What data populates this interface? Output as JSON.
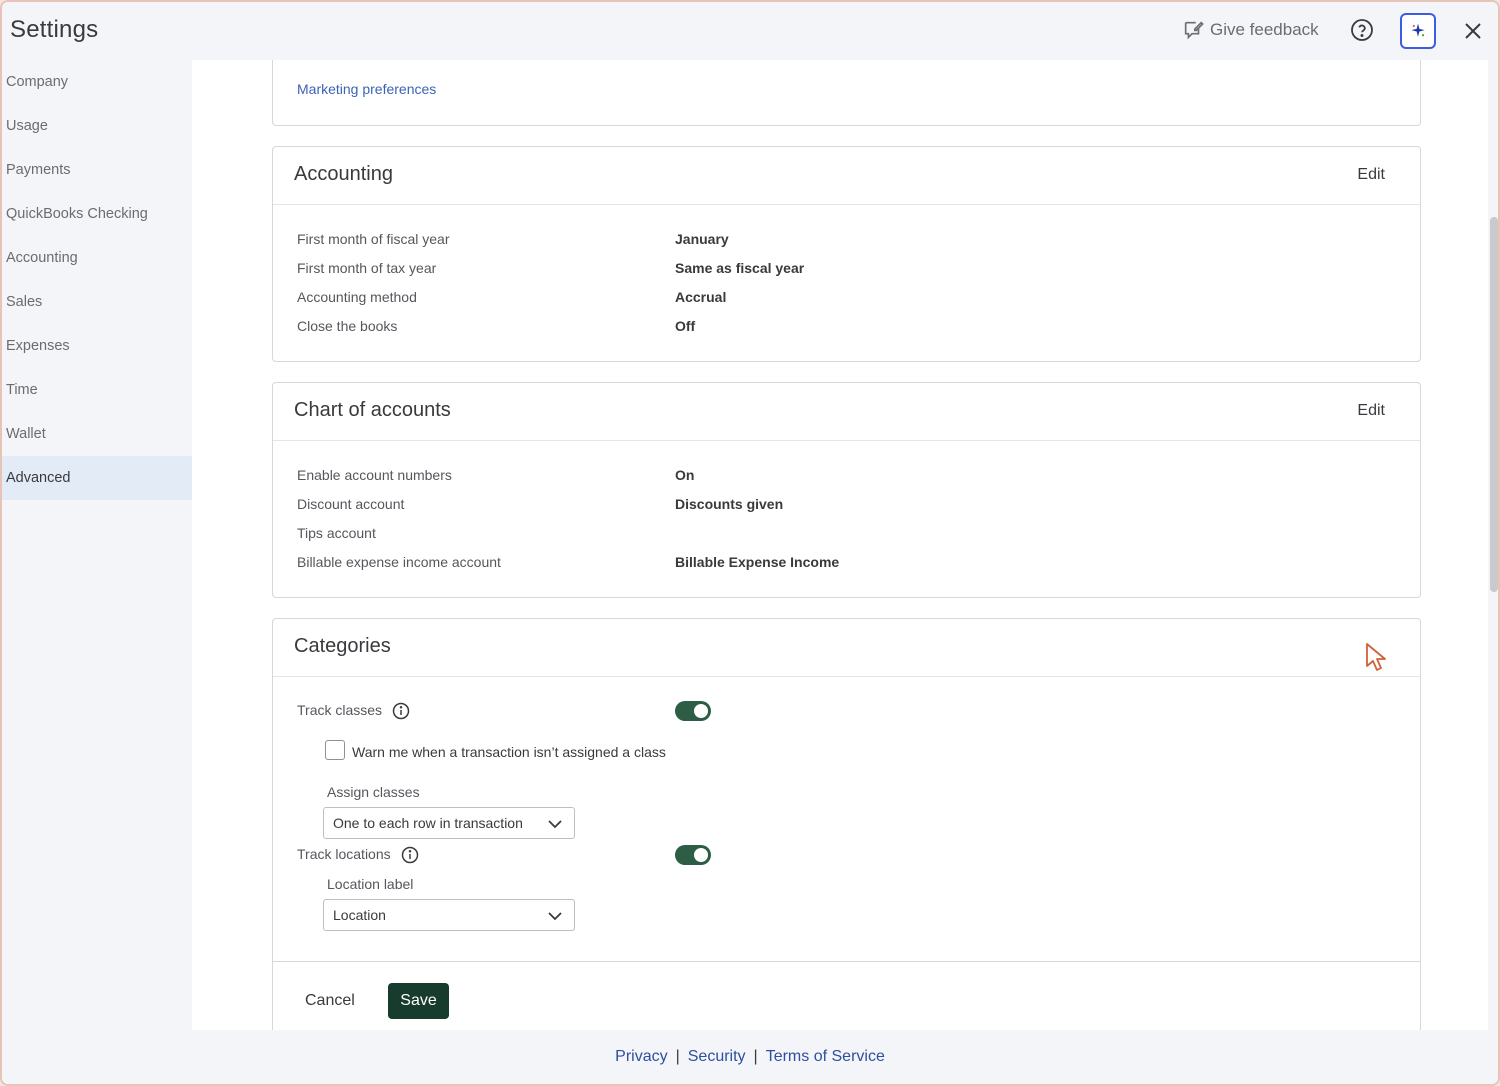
{
  "header": {
    "title": "Settings",
    "feedback_label": "Give feedback"
  },
  "sidebar": {
    "items": [
      {
        "label": "Company"
      },
      {
        "label": "Usage"
      },
      {
        "label": "Payments"
      },
      {
        "label": "QuickBooks Checking"
      },
      {
        "label": "Accounting"
      },
      {
        "label": "Sales"
      },
      {
        "label": "Expenses"
      },
      {
        "label": "Time"
      },
      {
        "label": "Wallet"
      },
      {
        "label": "Advanced"
      }
    ],
    "active": "Advanced"
  },
  "company_card": {
    "link": "Marketing preferences"
  },
  "accounting": {
    "title": "Accounting",
    "edit_label": "Edit",
    "rows": [
      {
        "label": "First month of fiscal year",
        "value": "January"
      },
      {
        "label": "First month of tax year",
        "value": "Same as fiscal year"
      },
      {
        "label": "Accounting method",
        "value": "Accrual"
      },
      {
        "label": "Close the books",
        "value": "Off"
      }
    ]
  },
  "chart_of_accounts": {
    "title": "Chart of accounts",
    "edit_label": "Edit",
    "rows": [
      {
        "label": "Enable account numbers",
        "value": "On"
      },
      {
        "label": "Discount account",
        "value": "Discounts given"
      },
      {
        "label": "Tips account",
        "value": ""
      },
      {
        "label": "Billable expense income account",
        "value": "Billable Expense Income"
      }
    ]
  },
  "categories": {
    "title": "Categories",
    "track_classes": {
      "label": "Track classes",
      "enabled": true
    },
    "warn_checkbox": {
      "label": "Warn me when a transaction isn’t assigned a class",
      "checked": false
    },
    "assign_classes": {
      "label": "Assign classes",
      "value": "One to each row in transaction"
    },
    "track_locations": {
      "label": "Track locations",
      "enabled": true
    },
    "location_label": {
      "label": "Location label",
      "value": "Location"
    },
    "cancel_label": "Cancel",
    "save_label": "Save"
  },
  "footer": {
    "privacy": "Privacy",
    "security": "Security",
    "terms": "Terms of Service",
    "separator": "|"
  },
  "colors": {
    "toggle_on": "#2e5d45",
    "save_button": "#173b2c",
    "link": "#3b63b5",
    "active_sidebar": "#e3ecf6",
    "assistant_border": "#3d5ce0"
  }
}
